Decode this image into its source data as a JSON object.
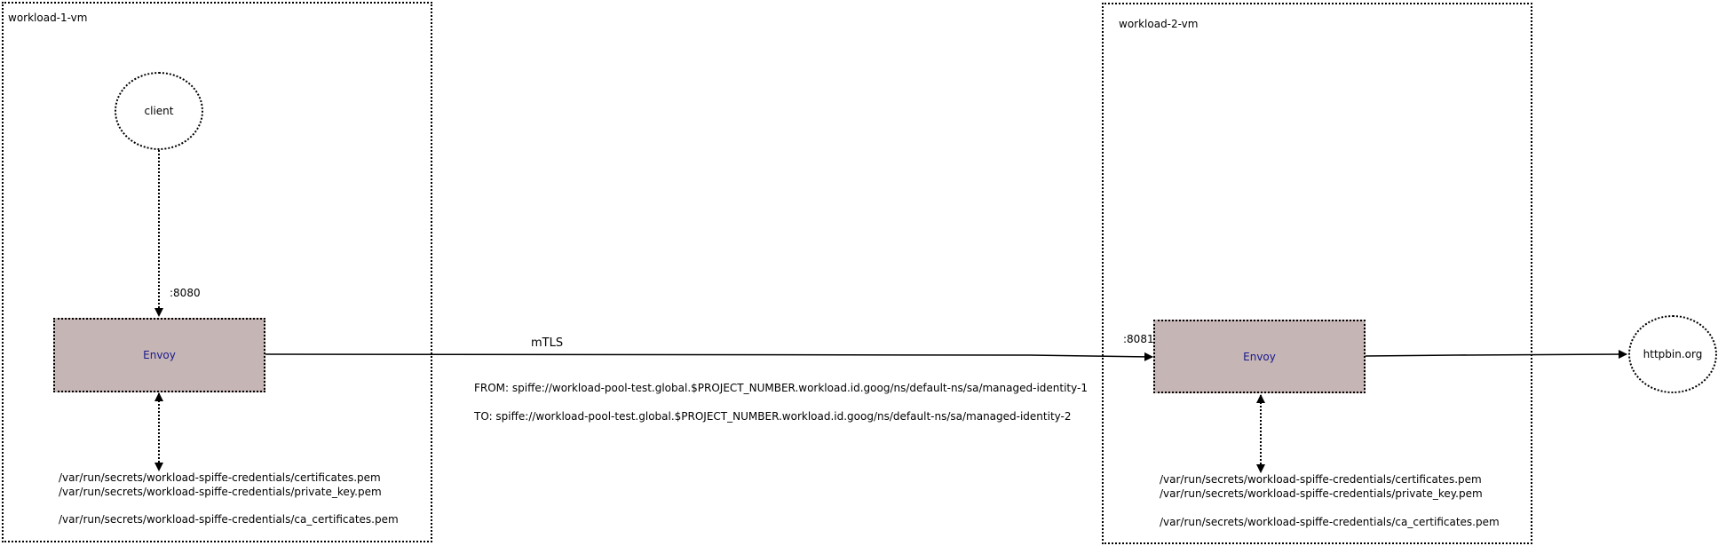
{
  "colors": {
    "envoy_fill": "#c6b5b5",
    "envoy_text": "#1a1a8c",
    "line": "#000000"
  },
  "vm1": {
    "label": "workload-1-vm",
    "client_label": "client",
    "port_label": ":8080",
    "envoy_label": "Envoy",
    "cert_path": "/var/run/secrets/workload-spiffe-credentials/certificates.pem",
    "key_path": "/var/run/secrets/workload-spiffe-credentials/private_key.pem",
    "ca_path": "/var/run/secrets/workload-spiffe-credentials/ca_certificates.pem"
  },
  "vm2": {
    "label": "workload-2-vm",
    "port_label": ":8081",
    "envoy_label": "Envoy",
    "cert_path": "/var/run/secrets/workload-spiffe-credentials/certificates.pem",
    "key_path": "/var/run/secrets/workload-spiffe-credentials/private_key.pem",
    "ca_path": "/var/run/secrets/workload-spiffe-credentials/ca_certificates.pem"
  },
  "link": {
    "protocol_label": "mTLS",
    "from_identity": "FROM: spiffe://workload-pool-test.global.$PROJECT_NUMBER.workload.id.goog/ns/default-ns/sa/managed-identity-1",
    "to_identity": "TO: spiffe://workload-pool-test.global.$PROJECT_NUMBER.workload.id.goog/ns/default-ns/sa/managed-identity-2"
  },
  "external": {
    "label": "httpbin.org"
  }
}
